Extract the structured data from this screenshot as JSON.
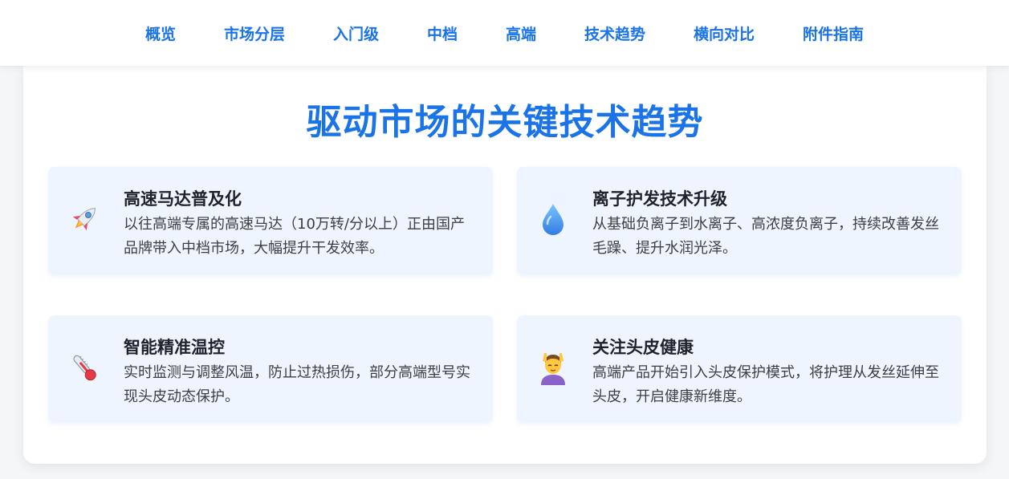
{
  "nav": {
    "items": [
      "概览",
      "市场分层",
      "入门级",
      "中档",
      "高端",
      "技术趋势",
      "横向对比",
      "附件指南"
    ]
  },
  "main": {
    "title": "驱动市场的关键技术趋势",
    "features": [
      {
        "icon": "rocket-icon",
        "title": "高速马达普及化",
        "desc": "以往高端专属的高速马达（10万转/分以上）正由国产品牌带入中档市场，大幅提升干发效率。"
      },
      {
        "icon": "droplet-icon",
        "title": "离子护发技术升级",
        "desc": "从基础负离子到水离子、高浓度负离子，持续改善发丝毛躁、提升水润光泽。"
      },
      {
        "icon": "thermometer-icon",
        "title": "智能精准温控",
        "desc": "实时监测与调整风温，防止过热损伤，部分高端型号实现头皮动态保护。"
      },
      {
        "icon": "head-massage-icon",
        "title": "关注头皮健康",
        "desc": "高端产品开始引入头皮保护模式，将护理从发丝延伸至头皮，开启健康新维度。"
      }
    ]
  },
  "colors": {
    "accent": "#1a73e8",
    "card_bg": "#eef5ff",
    "page_bg": "#f5f6f8"
  }
}
